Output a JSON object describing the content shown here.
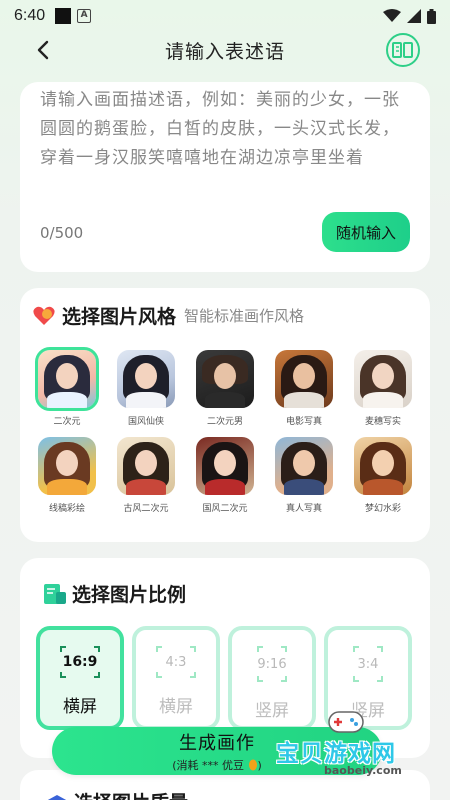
{
  "status_bar": {
    "time": "6:40"
  },
  "header": {
    "title": "请输入表述语"
  },
  "prompt": {
    "placeholder": "请输入画面描述语，例如：美丽的少女，一张圆圆的鹅蛋脸，白皙的皮肤，一头汉式长发，穿着一身汉服笑嘻嘻地在湖边凉亭里坐着",
    "char_count": "0/500",
    "random_button": "随机输入"
  },
  "style_section": {
    "title": "选择图片风格",
    "subtitle": "智能标准画作风格",
    "items": [
      {
        "label": "二次元",
        "selected": true
      },
      {
        "label": "国风仙侠",
        "selected": false
      },
      {
        "label": "二次元男",
        "selected": false
      },
      {
        "label": "电影写真",
        "selected": false
      },
      {
        "label": "麦穗写实",
        "selected": false
      },
      {
        "label": "线稿彩绘",
        "selected": false
      },
      {
        "label": "古风二次元",
        "selected": false
      },
      {
        "label": "国风二次元",
        "selected": false
      },
      {
        "label": "真人写真",
        "selected": false
      },
      {
        "label": "梦幻水彩",
        "selected": false
      }
    ]
  },
  "ratio_section": {
    "title": "选择图片比例",
    "tiles": [
      {
        "ratio": "16:9",
        "label": "横屏",
        "active": true
      },
      {
        "ratio": "4:3",
        "label": "横屏",
        "active": false
      },
      {
        "ratio": "9:16",
        "label": "竖屏",
        "active": false
      },
      {
        "ratio": "3:4",
        "label": "竖屏",
        "active": false
      }
    ]
  },
  "generate_button": {
    "title": "生成画作",
    "subtitle": "(消耗 *** 优豆"
  },
  "quality_section": {
    "title": "选择图片质量"
  },
  "watermark": {
    "text": "宝贝游戏网",
    "url": "baobeiy.com"
  },
  "colors": {
    "accent": "#2ce48e",
    "accent_dark": "#1a8f5a",
    "watermark": "#2ec8e8"
  }
}
